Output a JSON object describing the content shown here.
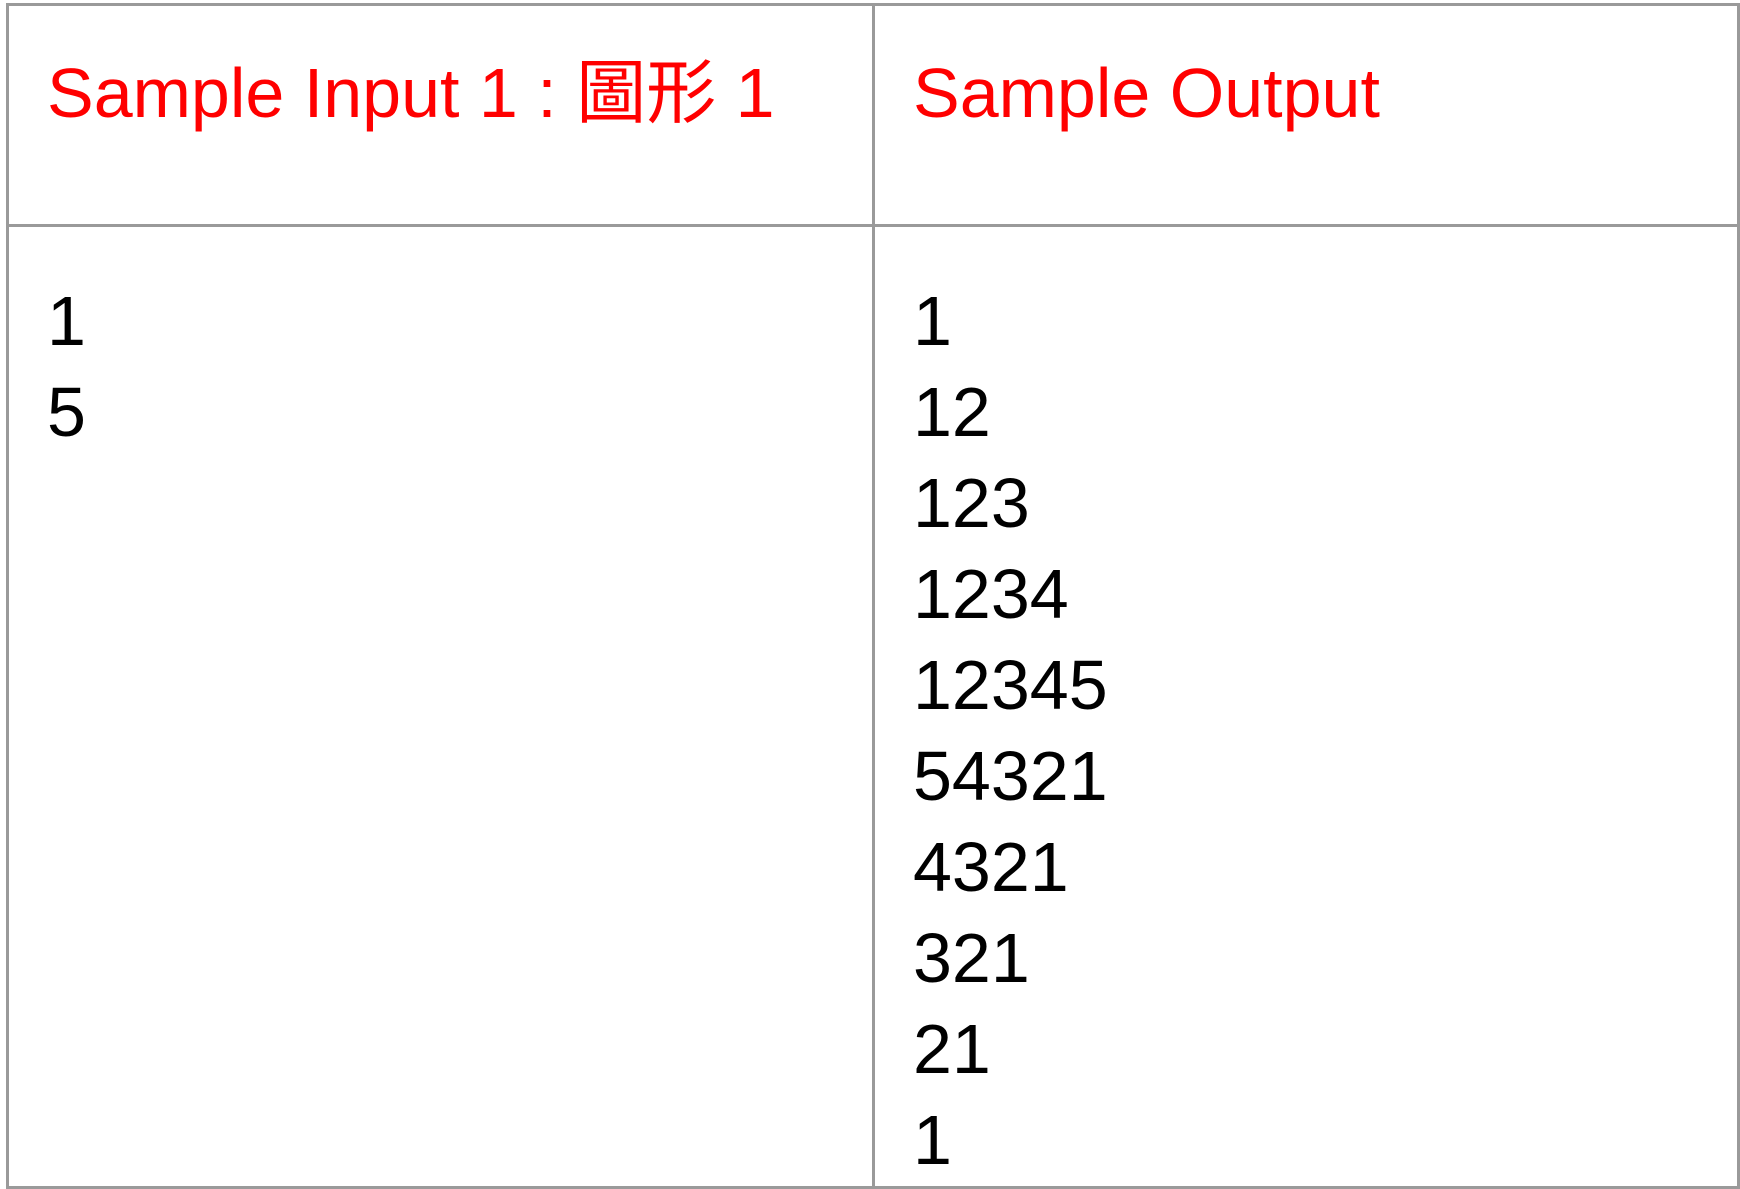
{
  "headers": {
    "input": "Sample Input 1 : 圖形 1",
    "output": "Sample Output"
  },
  "input_lines": [
    "1",
    "5"
  ],
  "output_lines": [
    "1",
    "12",
    "123",
    "1234",
    "12345",
    "54321",
    "4321",
    "321",
    "21",
    "1"
  ],
  "colors": {
    "header_text": "#ff0000",
    "body_text": "#000000",
    "border": "#9a9a9a"
  }
}
